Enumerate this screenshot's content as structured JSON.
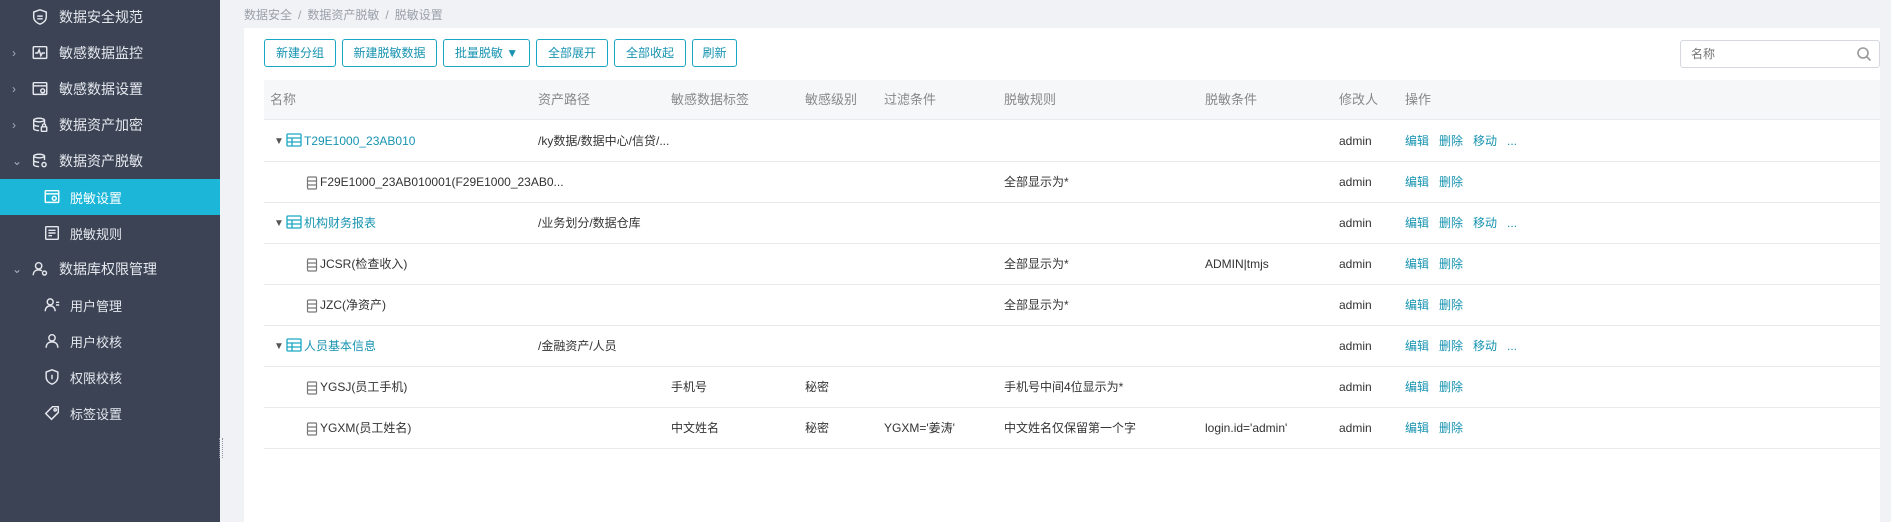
{
  "sidebar": {
    "items": [
      {
        "label": "数据安全规范",
        "icon": "shield-doc-icon",
        "chevron": ""
      },
      {
        "label": "敏感数据监控",
        "icon": "monitor-pulse-icon",
        "chevron": "›"
      },
      {
        "label": "敏感数据设置",
        "icon": "settings-window-icon",
        "chevron": "›"
      },
      {
        "label": "数据资产加密",
        "icon": "database-lock-icon",
        "chevron": "›"
      },
      {
        "label": "数据资产脱敏",
        "icon": "database-gear-icon",
        "chevron": "⌄"
      }
    ],
    "sub_desensitize": [
      {
        "label": "脱敏设置",
        "icon": "window-gear-icon"
      },
      {
        "label": "脱敏规则",
        "icon": "rules-icon"
      }
    ],
    "db_perm": {
      "label": "数据库权限管理",
      "icon": "user-gear-icon",
      "chevron": "⌄"
    },
    "sub_perm": [
      {
        "label": "用户管理",
        "icon": "user-list-icon"
      },
      {
        "label": "用户校核",
        "icon": "user-icon"
      },
      {
        "label": "权限校核",
        "icon": "shield-icon"
      },
      {
        "label": "标签设置",
        "icon": "tag-icon"
      }
    ]
  },
  "breadcrumb": [
    "数据安全",
    "/",
    "数据资产脱敏",
    "/",
    "脱敏设置"
  ],
  "toolbar": {
    "new_group": "新建分组",
    "new_desensitize": "新建脱敏数据",
    "batch_desensitize": "批量脱敏 ▼",
    "expand_all": "全部展开",
    "collapse_all": "全部收起",
    "refresh": "刷新",
    "search_placeholder": "名称"
  },
  "table": {
    "headers": [
      "名称",
      "资产路径",
      "敏感数据标签",
      "敏感级别",
      "过滤条件",
      "脱敏规则",
      "脱敏条件",
      "修改人",
      "操作"
    ],
    "actions": {
      "edit": "编辑",
      "delete": "删除",
      "move": "移动",
      "more": "..."
    },
    "rows": [
      {
        "type": "group",
        "name": "T29E1000_23AB010",
        "path": "/ky数据/数据中心/信贷/...",
        "tag": "",
        "level": "",
        "filter": "",
        "rule": "",
        "cond": "",
        "user": "admin"
      },
      {
        "type": "item",
        "name": "F29E1000_23AB010001(F29E1000_23AB0...",
        "path": "",
        "tag": "",
        "level": "",
        "filter": "",
        "rule": "全部显示为*",
        "cond": "",
        "user": "admin"
      },
      {
        "type": "group",
        "name": "机构财务报表",
        "path": "/业务划分/数据仓库",
        "tag": "",
        "level": "",
        "filter": "",
        "rule": "",
        "cond": "",
        "user": "admin"
      },
      {
        "type": "item",
        "name": "JCSR(检查收入)",
        "path": "",
        "tag": "",
        "level": "",
        "filter": "",
        "rule": "全部显示为*",
        "cond": "ADMIN|tmjs",
        "user": "admin"
      },
      {
        "type": "item",
        "name": "JZC(净资产)",
        "path": "",
        "tag": "",
        "level": "",
        "filter": "",
        "rule": "全部显示为*",
        "cond": "",
        "user": "admin"
      },
      {
        "type": "group",
        "name": "人员基本信息",
        "path": "/金融资产/人员",
        "tag": "",
        "level": "",
        "filter": "",
        "rule": "",
        "cond": "",
        "user": "admin"
      },
      {
        "type": "item",
        "name": "YGSJ(员工手机)",
        "path": "",
        "tag": "手机号",
        "level": "秘密",
        "filter": "",
        "rule": "手机号中间4位显示为*",
        "cond": "",
        "user": "admin"
      },
      {
        "type": "item",
        "name": "YGXM(员工姓名)",
        "path": "",
        "tag": "中文姓名",
        "level": "秘密",
        "filter": "YGXM='姜涛'",
        "rule": "中文姓名仅保留第一个字",
        "cond": "login.id='admin'",
        "user": "admin"
      }
    ]
  },
  "colors": {
    "sidebar_bg": "#3b4354",
    "active": "#1bb6d8",
    "link": "#1793b0"
  }
}
